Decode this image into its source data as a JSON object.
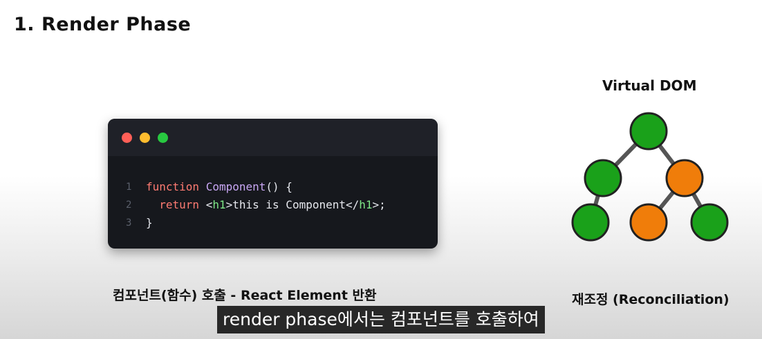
{
  "slide": {
    "title": "1. Render Phase",
    "left_caption": "컴포넌트(함수) 호출 - React Element 반환",
    "right_caption": "재조정 (Reconciliation)"
  },
  "code_window": {
    "dot_colors": [
      "#ff5f57",
      "#febc2e",
      "#28c840"
    ],
    "lines": [
      {
        "num": "1",
        "segments": [
          {
            "text": "function ",
            "style": "kw"
          },
          {
            "text": "Component",
            "style": "fn"
          },
          {
            "text": "() {",
            "style": "txt"
          }
        ]
      },
      {
        "num": "2",
        "segments": [
          {
            "text": "  return ",
            "style": "kw"
          },
          {
            "text": "<",
            "style": "txt"
          },
          {
            "text": "h1",
            "style": "tag"
          },
          {
            "text": ">this is Component</",
            "style": "txt"
          },
          {
            "text": "h1",
            "style": "tag"
          },
          {
            "text": ">;",
            "style": "txt"
          }
        ]
      },
      {
        "num": "3",
        "segments": [
          {
            "text": "}",
            "style": "txt"
          }
        ]
      }
    ]
  },
  "virtual_dom": {
    "title": "Virtual DOM",
    "colors": {
      "unchanged": "#1aa11a",
      "changed": "#f07d0a",
      "edge": "#555555",
      "stroke": "#222222"
    },
    "nodes": [
      "unchanged",
      "unchanged",
      "changed",
      "unchanged",
      "changed",
      "unchanged"
    ]
  },
  "subtitle": {
    "text": "render phase에서는 컴포넌트를 호출하여"
  }
}
